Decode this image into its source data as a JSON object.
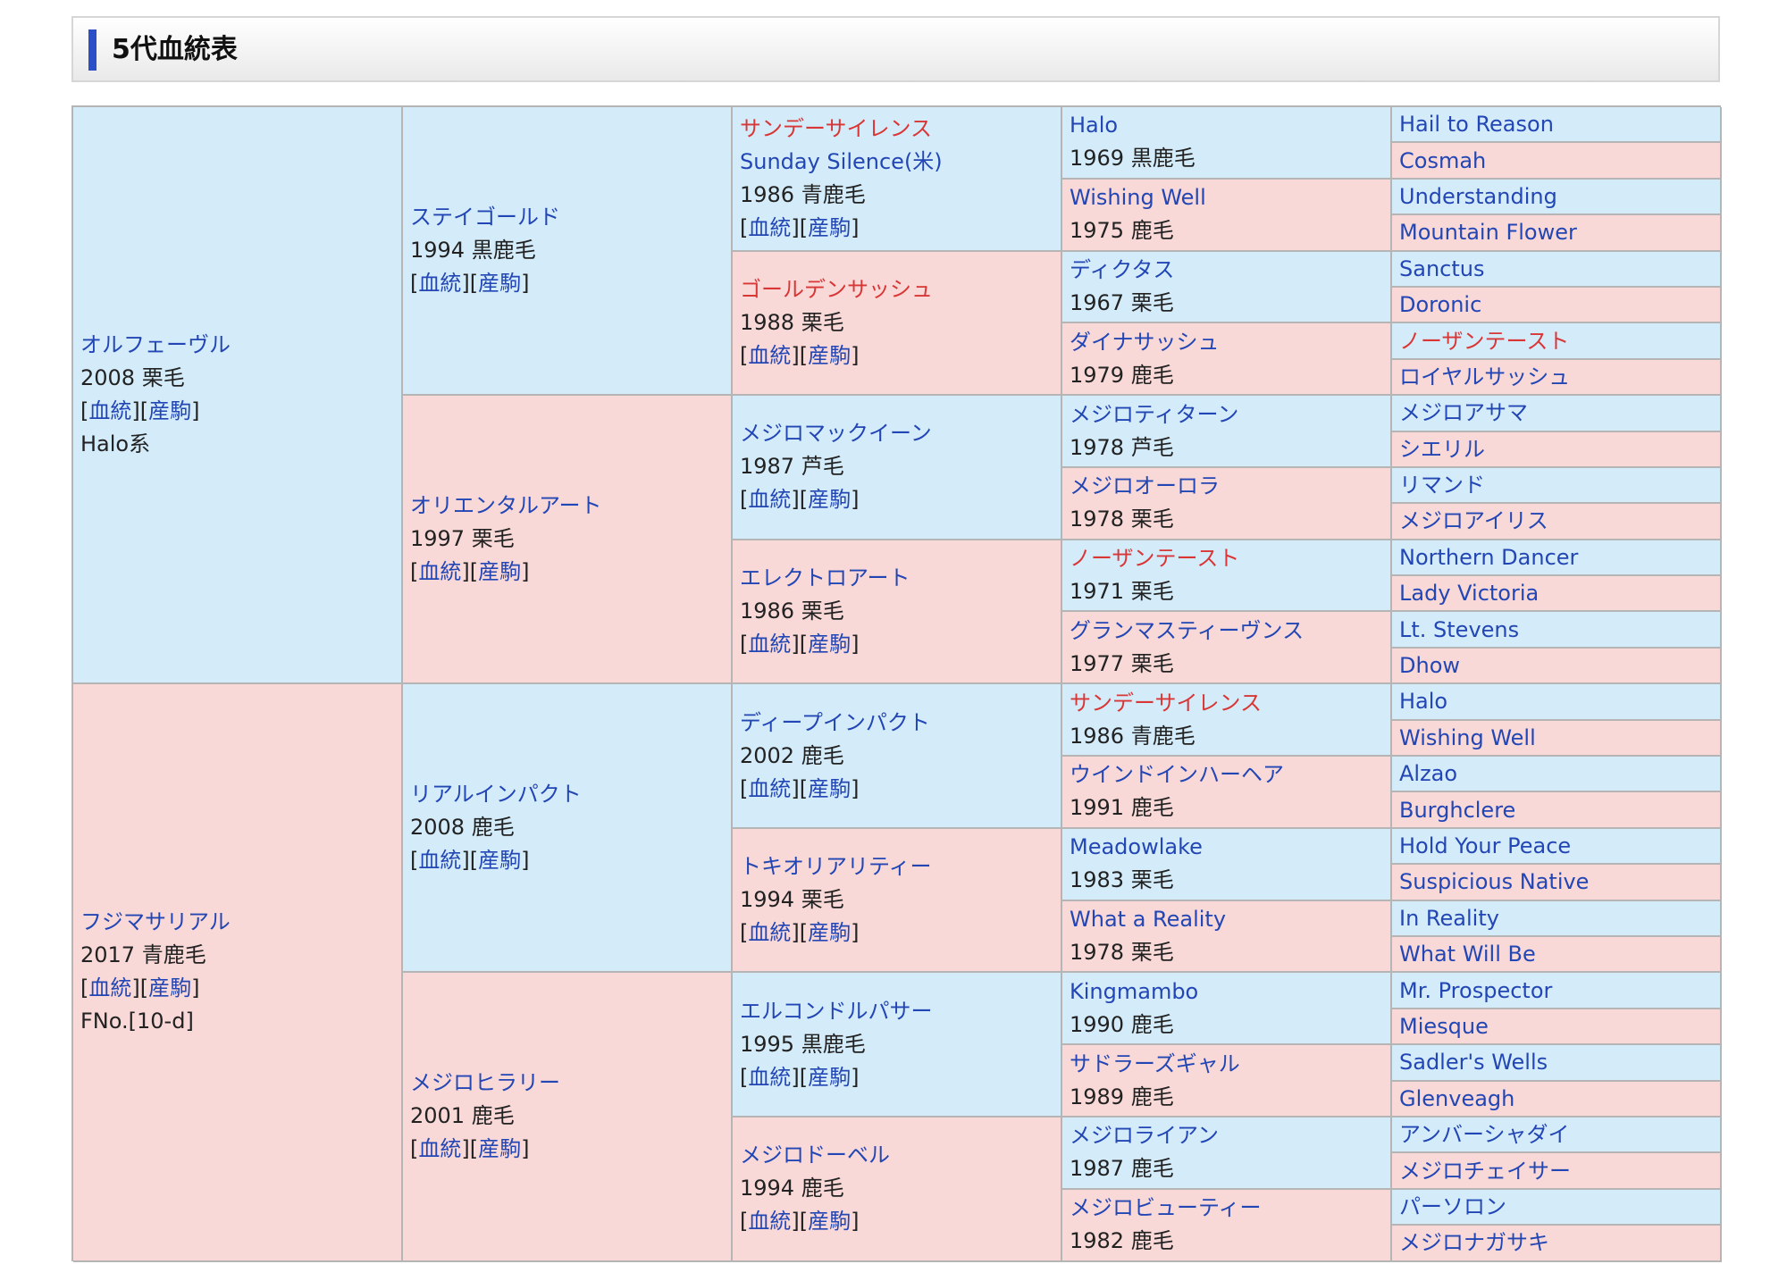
{
  "header": {
    "title": "5代血統表"
  },
  "links": {
    "bloodline": "血統",
    "offspring": "産駒"
  },
  "pedigree": {
    "gen1": [
      {
        "name": "オルフェーヴル",
        "info": "2008 栗毛",
        "extra": "Halo系",
        "sex": "sire",
        "red": false
      },
      {
        "name": "フジマサリアル",
        "info": "2017 青鹿毛",
        "extra": "FNo.[10-d]",
        "sex": "dam",
        "red": false
      }
    ],
    "gen2": [
      {
        "name": "ステイゴールド",
        "info": "1994 黒鹿毛",
        "sex": "sire",
        "red": false
      },
      {
        "name": "オリエンタルアート",
        "info": "1997 栗毛",
        "sex": "dam",
        "red": false
      },
      {
        "name": "リアルインパクト",
        "info": "2008 鹿毛",
        "sex": "sire",
        "red": false
      },
      {
        "name": "メジロヒラリー",
        "info": "2001 鹿毛",
        "sex": "dam",
        "red": false
      }
    ],
    "gen3": [
      {
        "name": "サンデーサイレンス",
        "name2": "Sunday Silence(米)",
        "info": "1986 青鹿毛",
        "sex": "sire",
        "red": true
      },
      {
        "name": "ゴールデンサッシュ",
        "info": "1988 栗毛",
        "sex": "dam",
        "red": true
      },
      {
        "name": "メジロマックイーン",
        "info": "1987 芦毛",
        "sex": "sire",
        "red": false
      },
      {
        "name": "エレクトロアート",
        "info": "1986 栗毛",
        "sex": "dam",
        "red": false
      },
      {
        "name": "ディープインパクト",
        "info": "2002 鹿毛",
        "sex": "sire",
        "red": false
      },
      {
        "name": "トキオリアリティー",
        "info": "1994 栗毛",
        "sex": "dam",
        "red": false
      },
      {
        "name": "エルコンドルパサー",
        "info": "1995 黒鹿毛",
        "sex": "sire",
        "red": false
      },
      {
        "name": "メジロドーベル",
        "info": "1994 鹿毛",
        "sex": "dam",
        "red": false
      }
    ],
    "gen4": [
      {
        "name": "Halo",
        "info": "1969 黒鹿毛",
        "sex": "sire",
        "red": false
      },
      {
        "name": "Wishing Well",
        "info": "1975 鹿毛",
        "sex": "dam",
        "red": false
      },
      {
        "name": "ディクタス",
        "info": "1967 栗毛",
        "sex": "sire",
        "red": false
      },
      {
        "name": "ダイナサッシュ",
        "info": "1979 鹿毛",
        "sex": "dam",
        "red": false
      },
      {
        "name": "メジロティターン",
        "info": "1978 芦毛",
        "sex": "sire",
        "red": false
      },
      {
        "name": "メジロオーロラ",
        "info": "1978 栗毛",
        "sex": "dam",
        "red": false
      },
      {
        "name": "ノーザンテースト",
        "info": "1971 栗毛",
        "sex": "sire",
        "red": true
      },
      {
        "name": "グランマスティーヴンス",
        "info": "1977 栗毛",
        "sex": "dam",
        "red": false
      },
      {
        "name": "サンデーサイレンス",
        "info": "1986 青鹿毛",
        "sex": "sire",
        "red": true
      },
      {
        "name": "ウインドインハーヘア",
        "info": "1991 鹿毛",
        "sex": "dam",
        "red": false
      },
      {
        "name": "Meadowlake",
        "info": "1983 栗毛",
        "sex": "sire",
        "red": false
      },
      {
        "name": "What a Reality",
        "info": "1978 栗毛",
        "sex": "dam",
        "red": false
      },
      {
        "name": "Kingmambo",
        "info": "1990 鹿毛",
        "sex": "sire",
        "red": false
      },
      {
        "name": "サドラーズギャル",
        "info": "1989 鹿毛",
        "sex": "dam",
        "red": false
      },
      {
        "name": "メジロライアン",
        "info": "1987 鹿毛",
        "sex": "sire",
        "red": false
      },
      {
        "name": "メジロビューティー",
        "info": "1982 鹿毛",
        "sex": "dam",
        "red": false
      }
    ],
    "gen5": [
      {
        "name": "Hail to Reason",
        "sex": "sire",
        "red": false
      },
      {
        "name": "Cosmah",
        "sex": "dam",
        "red": false
      },
      {
        "name": "Understanding",
        "sex": "sire",
        "red": false
      },
      {
        "name": "Mountain Flower",
        "sex": "dam",
        "red": false
      },
      {
        "name": "Sanctus",
        "sex": "sire",
        "red": false
      },
      {
        "name": "Doronic",
        "sex": "dam",
        "red": false
      },
      {
        "name": "ノーザンテースト",
        "sex": "sire",
        "red": true
      },
      {
        "name": "ロイヤルサッシュ",
        "sex": "dam",
        "red": false
      },
      {
        "name": "メジロアサマ",
        "sex": "sire",
        "red": false
      },
      {
        "name": "シエリル",
        "sex": "dam",
        "red": false
      },
      {
        "name": "リマンド",
        "sex": "sire",
        "red": false
      },
      {
        "name": "メジロアイリス",
        "sex": "dam",
        "red": false
      },
      {
        "name": "Northern Dancer",
        "sex": "sire",
        "red": false
      },
      {
        "name": "Lady Victoria",
        "sex": "dam",
        "red": false
      },
      {
        "name": "Lt. Stevens",
        "sex": "sire",
        "red": false
      },
      {
        "name": "Dhow",
        "sex": "dam",
        "red": false
      },
      {
        "name": "Halo",
        "sex": "sire",
        "red": false
      },
      {
        "name": "Wishing Well",
        "sex": "dam",
        "red": false
      },
      {
        "name": "Alzao",
        "sex": "sire",
        "red": false
      },
      {
        "name": "Burghclere",
        "sex": "dam",
        "red": false
      },
      {
        "name": "Hold Your Peace",
        "sex": "sire",
        "red": false
      },
      {
        "name": "Suspicious Native",
        "sex": "dam",
        "red": false
      },
      {
        "name": "In Reality",
        "sex": "sire",
        "red": false
      },
      {
        "name": "What Will Be",
        "sex": "dam",
        "red": false
      },
      {
        "name": "Mr. Prospector",
        "sex": "sire",
        "red": false
      },
      {
        "name": "Miesque",
        "sex": "dam",
        "red": false
      },
      {
        "name": "Sadler's Wells",
        "sex": "sire",
        "red": false
      },
      {
        "name": "Glenveagh",
        "sex": "dam",
        "red": false
      },
      {
        "name": "アンバーシャダイ",
        "sex": "sire",
        "red": false
      },
      {
        "name": "メジロチェイサー",
        "sex": "dam",
        "red": false
      },
      {
        "name": "パーソロン",
        "sex": "sire",
        "red": false
      },
      {
        "name": "メジロナガサキ",
        "sex": "dam",
        "red": false
      }
    ]
  }
}
